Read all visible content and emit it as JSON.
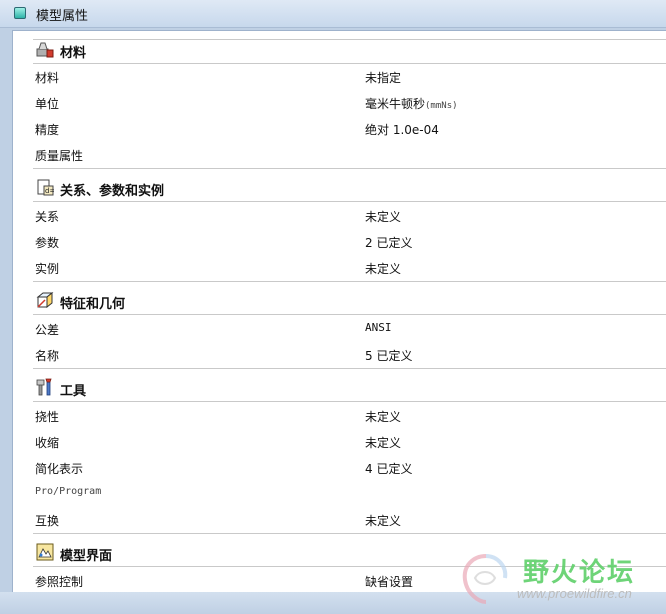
{
  "window": {
    "title": "模型属性"
  },
  "sections": [
    {
      "title": "材料",
      "icon": "material-icon",
      "rows": [
        {
          "label": "材料",
          "value": "未指定"
        },
        {
          "label": "单位",
          "value": "毫米牛顿秒",
          "value_suffix": "(mmNs)"
        },
        {
          "label": "精度",
          "value": "绝对 1.0e-04"
        },
        {
          "label": "质量属性",
          "value": ""
        }
      ]
    },
    {
      "title": "关系、参数和实例",
      "icon": "relations-icon",
      "rows": [
        {
          "label": "关系",
          "value": "未定义"
        },
        {
          "label": "参数",
          "value": "2 已定义"
        },
        {
          "label": "实例",
          "value": "未定义"
        }
      ]
    },
    {
      "title": "特征和几何",
      "icon": "features-icon",
      "rows": [
        {
          "label": "公差",
          "value": "ANSI"
        },
        {
          "label": "名称",
          "value": "5 已定义"
        }
      ]
    },
    {
      "title": "工具",
      "icon": "tools-icon",
      "rows": [
        {
          "label": "挠性",
          "value": "未定义"
        },
        {
          "label": "收缩",
          "value": "未定义"
        },
        {
          "label": "简化表示",
          "value": "4 已定义"
        },
        {
          "label": "Pro/Program",
          "value": ""
        },
        {
          "label": "互换",
          "value": "未定义"
        }
      ]
    },
    {
      "title": "模型界面",
      "icon": "model-interface-icon",
      "rows": [
        {
          "label": "参照控制",
          "value": "缺省设置"
        }
      ]
    }
  ],
  "watermark": {
    "text_cn": "野火论坛",
    "text_en": "www.proewildfire.cn"
  },
  "colors": {
    "accent": "#2fb3a8",
    "watermark_green": "#5fd06a",
    "titlebar": "#c7d8ec"
  }
}
